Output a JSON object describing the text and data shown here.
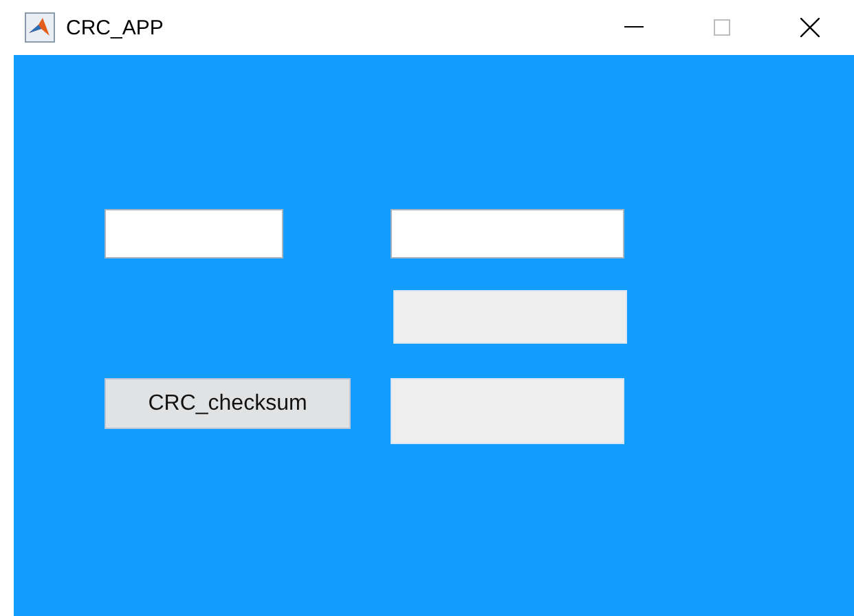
{
  "window": {
    "title": "CRC_APP"
  },
  "rows": [
    {
      "left": {
        "kind": "edit"
      },
      "right": {
        "kind": "edit"
      }
    },
    {
      "right": {
        "kind": "output"
      }
    },
    {
      "left": {
        "kind": "button",
        "label": "CRC_checksum"
      },
      "right": {
        "kind": "output"
      }
    }
  ]
}
